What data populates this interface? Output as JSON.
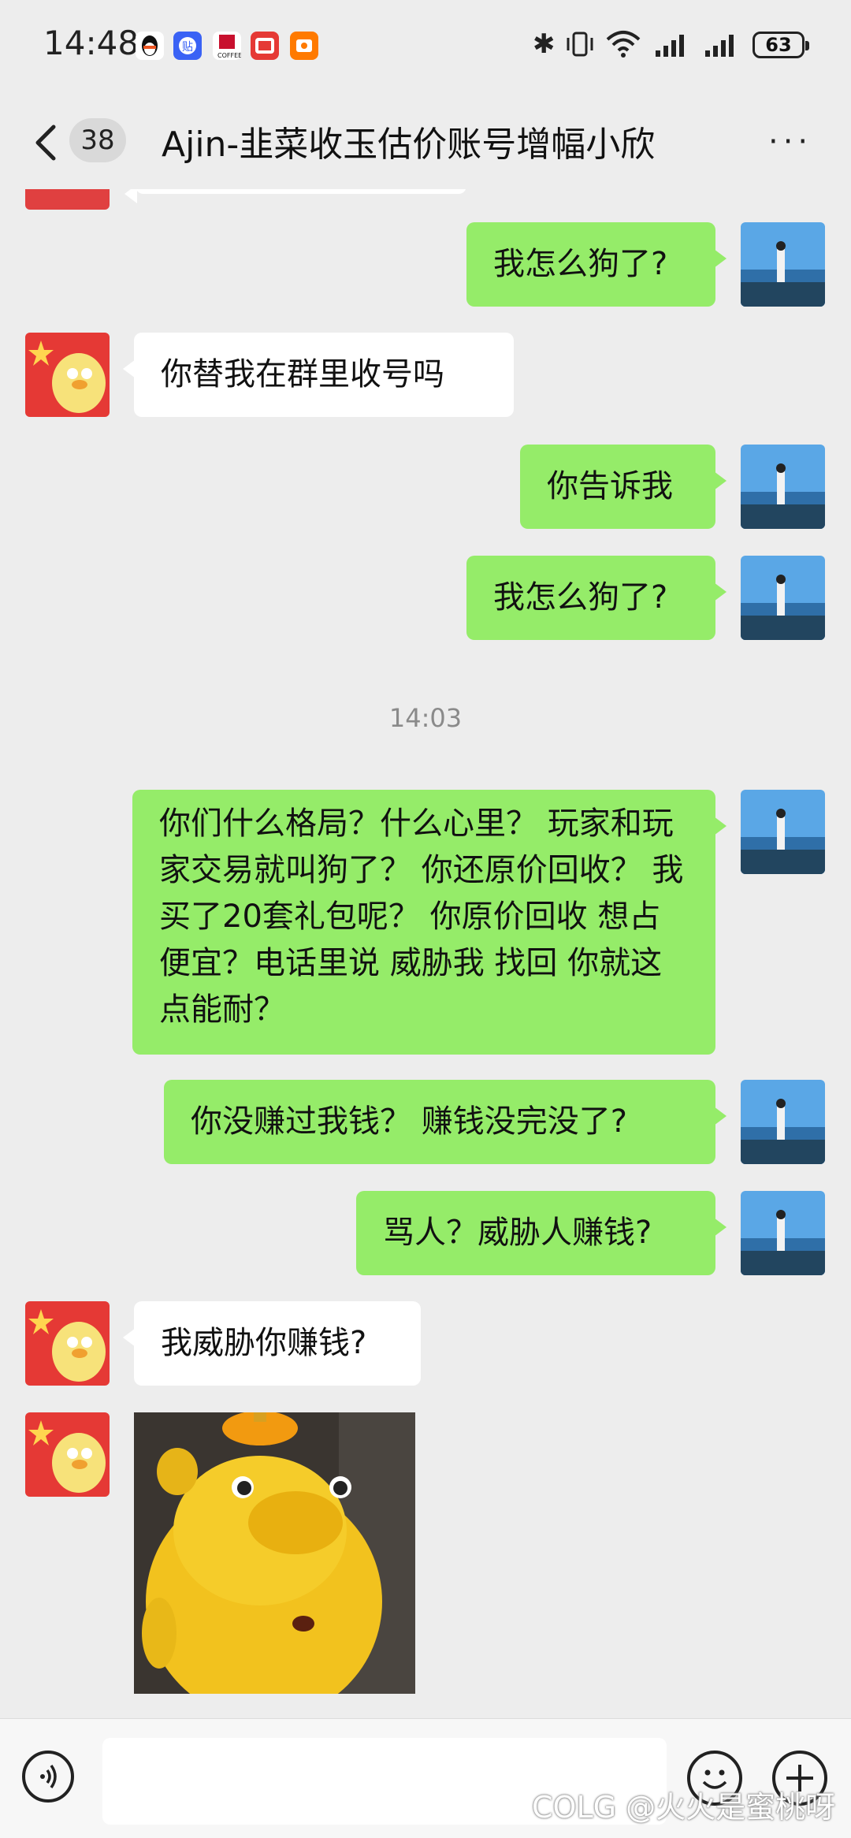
{
  "status_bar": {
    "time": "14:48",
    "battery": "63",
    "app_icons": [
      {
        "name": "qq-icon",
        "color": "#111111"
      },
      {
        "name": "tieba-icon",
        "color": "#3a62f5"
      },
      {
        "name": "kfc-coffee-icon",
        "color": "#c8102e"
      },
      {
        "name": "fast-food-app-icon",
        "color": "#e53935"
      },
      {
        "name": "orange-app-icon",
        "color": "#ff7a00"
      }
    ]
  },
  "header": {
    "unread_count": "38",
    "title": "Ajin-韭菜收玉估价账号增幅小欣",
    "more_label": "···"
  },
  "messages": [
    {
      "from": "me",
      "text": "我怎么狗了?"
    },
    {
      "from": "them",
      "text": "你替我在群里收号吗"
    },
    {
      "from": "me",
      "text": "你告诉我"
    },
    {
      "from": "me",
      "text": "我怎么狗了?"
    },
    {
      "from": "me",
      "text": "你们什么格局？什么心里？ 玩家和玩家交易就叫狗了？ 你还原价回收？ 我买了20套礼包呢？ 你原价回收 想占便宜？电话里说 威胁我 找回 你就这点能耐？"
    },
    {
      "from": "me",
      "text": "你没赚过我钱？ 赚钱没完没了?"
    },
    {
      "from": "me",
      "text": "骂人？威胁人赚钱?"
    },
    {
      "from": "them",
      "text": "我威胁你赚钱?"
    },
    {
      "from": "them",
      "type": "sticker",
      "text": ""
    }
  ],
  "timestamp": "14:03",
  "input_bar": {
    "text_value": ""
  },
  "watermark": "COLG @火火是蜜桃呀",
  "colors": {
    "my_bubble": "#95ec69",
    "their_bubble": "#ffffff",
    "background": "#ededed"
  }
}
